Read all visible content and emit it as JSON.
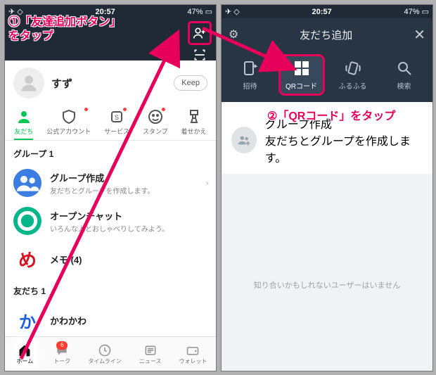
{
  "status": {
    "time": "20:57",
    "battery": "47%",
    "batt_icon": "□"
  },
  "left": {
    "profile_name": "すず",
    "keep": "Keep",
    "tabs": [
      {
        "label": "友だち",
        "active": true
      },
      {
        "label": "公式アカウント"
      },
      {
        "label": "サービス"
      },
      {
        "label": "スタンプ"
      },
      {
        "label": "着せかえ"
      }
    ],
    "group_header": "グループ 1",
    "rows": [
      {
        "title": "グループ作成",
        "sub": "友だちとグループを作成します。",
        "color": "#3b7de0",
        "icon": "grp"
      },
      {
        "title": "オープンチャット",
        "sub": "いろんな人とおしゃべりしてみよう。",
        "color": "#07b58b",
        "icon": "open"
      },
      {
        "title": "メモ (4)",
        "sub": "",
        "color": "#d4141e",
        "icon": "memo"
      }
    ],
    "friends_header": "友だち 1",
    "friend_row": {
      "title": "かわかわ",
      "color": "#1a5fe0",
      "letter": "か"
    },
    "bottom": [
      {
        "label": "ホーム",
        "active": true
      },
      {
        "label": "トーク",
        "badge": "6"
      },
      {
        "label": "タイムライン"
      },
      {
        "label": "ニュース"
      },
      {
        "label": "ウォレット"
      }
    ]
  },
  "right": {
    "title": "友だち追加",
    "methods": [
      {
        "label": "招待",
        "icon": "invite"
      },
      {
        "label": "QRコード",
        "icon": "qr",
        "active": true
      },
      {
        "label": "ふるふる",
        "icon": "shake"
      },
      {
        "label": "検索",
        "icon": "search"
      }
    ],
    "group": {
      "title": "グループ作成",
      "sub": "友だちとグループを作成します。"
    },
    "empty": "知り合いかもしれないユーザーはいません"
  },
  "anno": {
    "step1": "①「友達追加ボタン」\nをタップ",
    "step2": "②「QRコード」をタップ"
  }
}
